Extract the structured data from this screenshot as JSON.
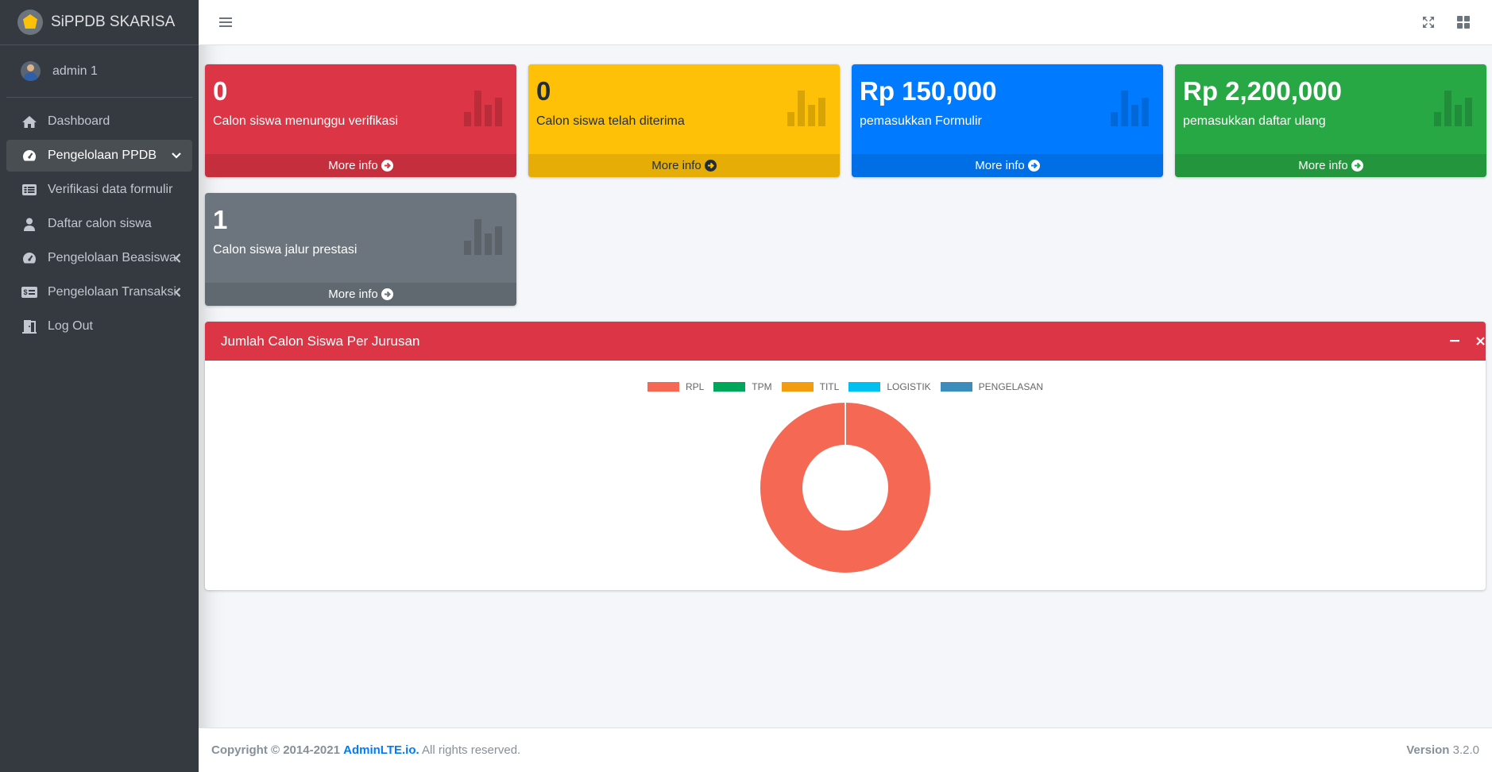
{
  "brand": {
    "name": "SiPPDB SKARISA"
  },
  "user": {
    "name": "admin 1"
  },
  "sidebar": {
    "items": [
      {
        "label": "Dashboard"
      },
      {
        "label": "Pengelolaan PPDB"
      },
      {
        "label": "Verifikasi data formulir"
      },
      {
        "label": "Daftar calon siswa"
      },
      {
        "label": "Pengelolaan Beasiswa"
      },
      {
        "label": "Pengelolaan Transaksi"
      },
      {
        "label": "Log Out"
      }
    ]
  },
  "boxes": [
    {
      "value": "0",
      "label": "Calon siswa menunggu verifikasi",
      "more": "More info",
      "color": "#dc3545"
    },
    {
      "value": "0",
      "label": "Calon siswa telah diterima",
      "more": "More info",
      "color": "#ffc107"
    },
    {
      "value": "Rp 150,000",
      "label": "pemasukkan Formulir",
      "more": "More info",
      "color": "#007bff"
    },
    {
      "value": "Rp 2,200,000",
      "label": "pemasukkan daftar ulang",
      "more": "More info",
      "color": "#28a745"
    },
    {
      "value": "1",
      "label": "Calon siswa jalur prestasi",
      "more": "More info",
      "color": "#6c757d"
    }
  ],
  "card": {
    "title": "Jumlah Calon Siswa Per Jurusan"
  },
  "chart_data": {
    "type": "pie",
    "donut": true,
    "categories": [
      "RPL",
      "TPM",
      "TITL",
      "LOGISTIK",
      "PENGELASAN"
    ],
    "values": [
      1,
      0,
      0,
      0,
      0
    ],
    "colors": [
      "#f56954",
      "#00a65a",
      "#f39c12",
      "#00c0ef",
      "#3c8dbc"
    ],
    "legend": "top"
  },
  "footer": {
    "copyright": "Copyright © 2014-2021",
    "link": "AdminLTE.io.",
    "rights": "All rights reserved.",
    "version_label": "Version",
    "version": "3.2.0"
  }
}
